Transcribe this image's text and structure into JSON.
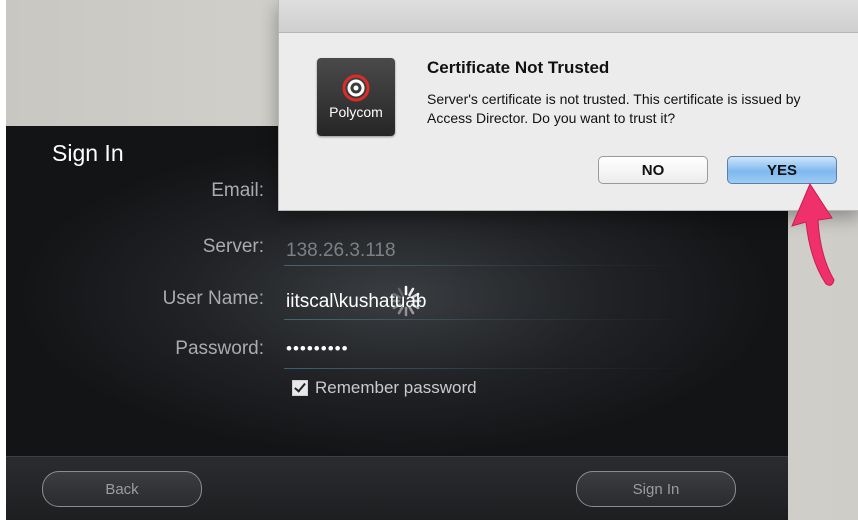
{
  "signin": {
    "title": "Sign In",
    "labels": {
      "email": "Email:",
      "server": "Server:",
      "username": "User Name:",
      "password": "Password:"
    },
    "values": {
      "server": "138.26.3.118",
      "username": "iitscal\\kushatuab",
      "password": "•••••••••"
    },
    "remember_label": "Remember password",
    "remember_checked": true,
    "back_label": "Back",
    "signin_label": "Sign In"
  },
  "dialog": {
    "logo_text": "Polycom",
    "title": "Certificate Not Trusted",
    "message": "Server's certificate is not trusted. This certificate is issued by Access Director. Do you want to trust it?",
    "no_label": "NO",
    "yes_label": "YES"
  },
  "colors": {
    "arrow": "#f0306a",
    "yes_button": "#7fb8ef"
  }
}
